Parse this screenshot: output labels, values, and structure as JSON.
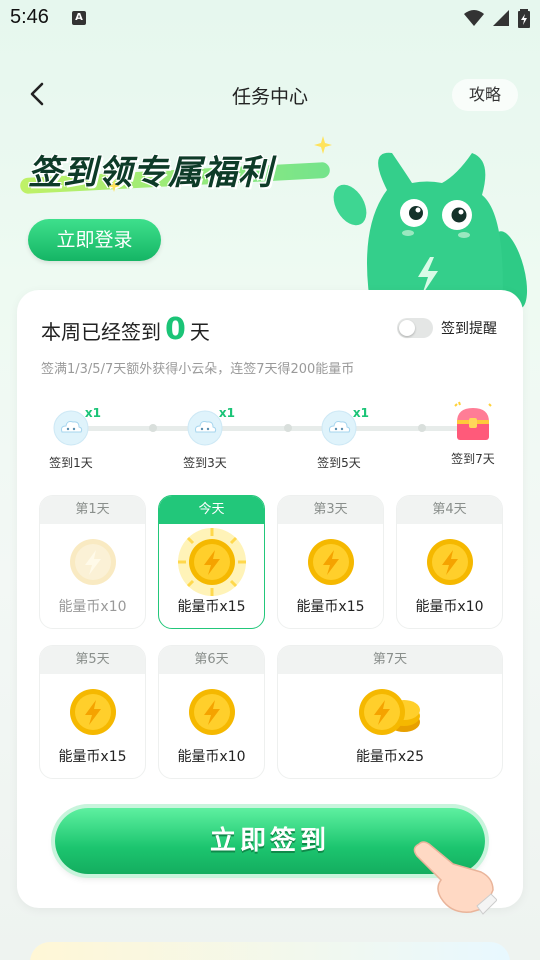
{
  "status": {
    "time": "5:46",
    "a_badge": "A"
  },
  "nav": {
    "title": "任务中心",
    "guide": "攻略"
  },
  "banner": {
    "title": "签到领专属福利",
    "login": "立即登录"
  },
  "checkin": {
    "week_prefix": "本周已经签到",
    "week_count": "0",
    "week_suffix": "天",
    "remind_label": "签到提醒",
    "description": "签满1/3/5/7天额外获得小云朵，连签7天得200能量币",
    "milestones": [
      {
        "label": "签到1天",
        "bonus": "x1",
        "reward": "cloud"
      },
      {
        "label": "签到3天",
        "bonus": "x1",
        "reward": "cloud"
      },
      {
        "label": "签到5天",
        "bonus": "x1",
        "reward": "cloud"
      },
      {
        "label": "签到7天",
        "bonus": "",
        "reward": "treasure-chest"
      }
    ],
    "days": [
      {
        "head": "第1天",
        "reward": "能量币x10",
        "state": "missed"
      },
      {
        "head": "今天",
        "reward": "能量币x15",
        "state": "today"
      },
      {
        "head": "第3天",
        "reward": "能量币x15",
        "state": "upcoming"
      },
      {
        "head": "第4天",
        "reward": "能量币x10",
        "state": "upcoming"
      },
      {
        "head": "第5天",
        "reward": "能量币x15",
        "state": "upcoming"
      },
      {
        "head": "第6天",
        "reward": "能量币x10",
        "state": "upcoming"
      },
      {
        "head": "第7天",
        "reward": "能量币x25",
        "state": "upcoming"
      }
    ],
    "signin_button": "立即签到"
  },
  "colors": {
    "accent": "#1bc477",
    "coin": "#f5b800"
  }
}
